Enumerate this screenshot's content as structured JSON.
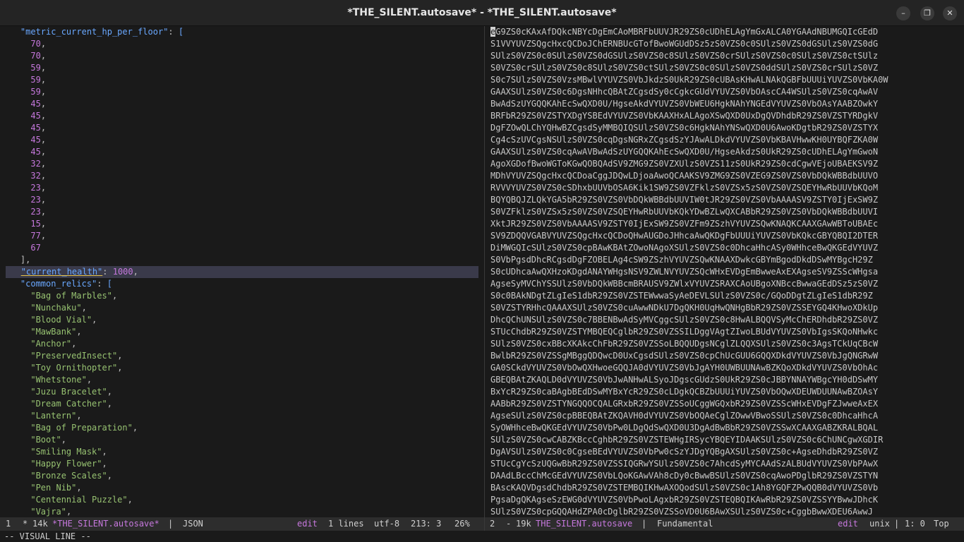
{
  "window": {
    "title": "*THE_SILENT.autosave* - *THE_SILENT.autosave*",
    "minimize_glyph": "–",
    "maximize_glyph": "❐",
    "close_glyph": "✕"
  },
  "left_pane": {
    "lines": [
      {
        "indent": "  ",
        "key": "\"metric_current_hp_per_floor\"",
        "after": ": ",
        "open": "["
      },
      {
        "indent": "    ",
        "num": "70",
        "after": ","
      },
      {
        "indent": "    ",
        "num": "70",
        "after": ","
      },
      {
        "indent": "    ",
        "num": "59",
        "after": ","
      },
      {
        "indent": "    ",
        "num": "59",
        "after": ","
      },
      {
        "indent": "    ",
        "num": "59",
        "after": ","
      },
      {
        "indent": "    ",
        "num": "45",
        "after": ","
      },
      {
        "indent": "    ",
        "num": "45",
        "after": ","
      },
      {
        "indent": "    ",
        "num": "45",
        "after": ","
      },
      {
        "indent": "    ",
        "num": "45",
        "after": ","
      },
      {
        "indent": "    ",
        "num": "45",
        "after": ","
      },
      {
        "indent": "    ",
        "num": "32",
        "after": ","
      },
      {
        "indent": "    ",
        "num": "32",
        "after": ","
      },
      {
        "indent": "    ",
        "num": "23",
        "after": ","
      },
      {
        "indent": "    ",
        "num": "23",
        "after": ","
      },
      {
        "indent": "    ",
        "num": "23",
        "after": ","
      },
      {
        "indent": "    ",
        "num": "15",
        "after": ","
      },
      {
        "indent": "    ",
        "num": "77",
        "after": ","
      },
      {
        "indent": "    ",
        "num": "67",
        "after": ""
      },
      {
        "indent": "  ",
        "punc": "],"
      },
      {
        "indent": "  ",
        "key": "\"current_health\"",
        "after": ": ",
        "num": "1000",
        "tail": ",",
        "highlight": true
      },
      {
        "indent": "  ",
        "key": "\"common_relics\"",
        "after": ": ",
        "open": "["
      },
      {
        "indent": "    ",
        "str": "\"Bag of Marbles\"",
        "after": ","
      },
      {
        "indent": "    ",
        "str": "\"Nunchaku\"",
        "after": ","
      },
      {
        "indent": "    ",
        "str": "\"Blood Vial\"",
        "after": ","
      },
      {
        "indent": "    ",
        "str": "\"MawBank\"",
        "after": ","
      },
      {
        "indent": "    ",
        "str": "\"Anchor\"",
        "after": ","
      },
      {
        "indent": "    ",
        "str": "\"PreservedInsect\"",
        "after": ","
      },
      {
        "indent": "    ",
        "str": "\"Toy Ornithopter\"",
        "after": ","
      },
      {
        "indent": "    ",
        "str": "\"Whetstone\"",
        "after": ","
      },
      {
        "indent": "    ",
        "str": "\"Juzu Bracelet\"",
        "after": ","
      },
      {
        "indent": "    ",
        "str": "\"Dream Catcher\"",
        "after": ","
      },
      {
        "indent": "    ",
        "str": "\"Lantern\"",
        "after": ","
      },
      {
        "indent": "    ",
        "str": "\"Bag of Preparation\"",
        "after": ","
      },
      {
        "indent": "    ",
        "str": "\"Boot\"",
        "after": ","
      },
      {
        "indent": "    ",
        "str": "\"Smiling Mask\"",
        "after": ","
      },
      {
        "indent": "    ",
        "str": "\"Happy Flower\"",
        "after": ","
      },
      {
        "indent": "    ",
        "str": "\"Bronze Scales\"",
        "after": ","
      },
      {
        "indent": "    ",
        "str": "\"Pen Nib\"",
        "after": ","
      },
      {
        "indent": "    ",
        "str": "\"Centennial Puzzle\"",
        "after": ","
      },
      {
        "indent": "    ",
        "str": "\"Vajra\"",
        "after": ","
      }
    ]
  },
  "right_pane": {
    "first_char": "e",
    "lines": [
      "G9ZS0cKAxAfDQkcNBYcDgEmCAoMBRFbUUVJR29ZS0cUDhELAgYmGxALCA0YGAAdNBUMGQIcGEdD",
      "S1VVYUVZSQgcHxcQCDoJChERNBUcGTofBwoWGUdDSz5zS0VZS0c0SUlzS0VZS0dGSUlzS0VZS0dG",
      "SUlzS0VZS0c0SUlzS0VZS0dGSUlzS0VZS0c8SUlzS0VZS0crSUlzS0VZS0c0SUlzS0VZS0ctSUlz",
      "S0VZS0crSUlzS0VZS0c8SUlzS0VZS0ctSUlzS0VZS0c0SUlzS0VZS0ddSUlzS0VZS0crSUlzS0VZ",
      "S0c7SUlzS0VZS0VzsMBwlVYUVZS0VbJkdzS0UkR29ZS0cUBAsKHwALNAkQGBFbUUUiYUVZS0VbKA0W",
      "GAAXSUlzS0VZS0c6DgsNHhcQBAtZCgsdSy0cCgkcGUdVYUVZS0VbOAscCA4WSUlzS0VZS0cqAwAV",
      "BwAdSzUYGQQKAhEcSwQXD0U/HgseAkdVYUVZS0VbWEU6HgkNAhYNGEdVYUVZS0VbOAsYAABZOwkY",
      "BRFbR29ZS0VZSTYXDgYSBEdVYUVZS0VbKAAXHxALAgoXSwQXD0UxDgQVDhdbR29ZS0VZSTYRDgkV",
      "DgFZOwQLChYQHwBZCgsdSyMMBQIQSUlzS0VZS0c6HgkNAhYNSwQXD0U6AwoKDgtbR29ZS0VZSTYX",
      "Cg4cSzUVCgsNSUlzS0VZS0cqDgsNGRxZCgsdSzYJAwALDkdVYUVZS0VbKBAVHwwKH0UYBQFZKA0W",
      "GAAXSUlzS0VZS0cqAwAVBwAdSzUYGQQKAhEcSwQXD0U/HgseAkdzS0UkR29ZS0cUDhELAgYmGwoN",
      "AgoXGDofBwoWGToKGwQOBQAdSV9ZMG9ZS0VZXUlzS0VZS11zS0UkR29ZS0cdCgwVEjoUBAEKSV9Z",
      "MDhVYUVZSQgcHxcQCDoaCggJDQwLDjoaAwoQCAAKSV9ZMG9ZS0VZEG9ZS0VZS0VbDQkWBBdbUUVO",
      "RVVVYUVZS0VZS0cSDhxbUUVbOSA6Kik1SW9ZS0VZFklzS0VZSx5zS0VZS0VZSQEYHwRbUUVbKQoM",
      "BQYQBQJZLQkYGA5bR29ZS0VZS0VbDQkWBBdbUUVIW0tJR29ZS0VZS0VbAAAASV9ZSTY0IjExSW9Z",
      "S0VZFklzS0VZSx5zS0VZS0VZSQEYHwRbUUVbKQkYDwBZLwQXCABbR29ZS0VZS0VbDQkWBBdbUUVI",
      "XktJR29ZS0VZS0VbAAAASV9ZSTY0IjExSW9ZS0VZFm9ZSzhVYUVZSQwKNAQKCAAXGAwWBToUBAEc",
      "SV9ZDQQVGABVYUVZSQgcHxcQCDoQHwAUGDoJHhcaAwQKDgFbUUUiYUVZS0VbKQkcGBYQBQI2DTER",
      "DiMWGQIcSUlzS0VZS0cpBAwKBAtZOwoNAgoXSUlzS0VZS0c0DhcaHhcASy0WHhceBwQKGEdVYUVZ",
      "S0VbPgsdDhcRCgsdDgFZOBELAg4cSW9ZSzhVYUVZSQwKNAAXDwkcGBYmBgodDkdDSwMYBgcH29Z",
      "S0cUDhcaAwQXHzoKDgdANAYWHgsNSV9ZWLNVYUVZSQcWHxEVDgEmBwweAxEXAgseSV9ZSScWHgsa",
      "AgseSyMVChYSSUlzS0VbDQkWBBcmBRAUSV9ZWlxVYUVZSRAXCAoUBgoXNBccBwwaGEdDSz5zS0VZ",
      "S0c0BAkNDgtZLgIeS1dbR29ZS0VZSTEWwwaSyAeDEVLSUlzS0VZS0c/GQoDDgtZLgIeS1dbR29Z",
      "S0VZSTYRHhcQAAAXSUlzS0VZS0cuAwwNDkU7DgQKH0UqHwQNHgBbR29ZS0VZSSEYGQ4KHwoXDkUp",
      "DhcQChUNSUlzS0VZS0c7BBENBwAdSyMVCggcSUlzS0VZS0c8HwALBQQVSyMcChERDhdbR29ZS0VZ",
      "STUcChdbR29ZS0VZSTYMBQEQCglbR29ZS0VZSSILDggVAgtZIwoLBUdVYUVZS0VbIgsSKQoNHwkc",
      "SUlzS0VZS0cxBBcXKAkcChFbR29ZS0VZSSoLBQQUDgsNCglZLQQXSUlzS0VZS0c3AgsTCkUqCBcW",
      "BwlbR29ZS0VZSSgMBggQDQwcD0UxCgsdSUlzS0VZS0cpChUcGUU6GQQXDkdVYUVZS0VbJgQNGRwW",
      "GA0SCkdVYUVZS0VbOwQXHwoeGQQJA0dVYUVZS0VbJgAYH0UWBUUNAwBZKQoXDkdVYUVZS0VbOhAc",
      "GBEQBAtZKAQLD0dVYUVZS0VbJwANHwALSyoJDgscGUdzS0UkR29ZS0cJBBYNNAYWBgcYH0dDSwMY",
      "BxYcR29ZS0caBAgbBEdDSwMYBxYcR29ZS0cLDgkQCBZbUUUiYUVZS0VbOQwXDEUWDUUNAwBZOAsY",
      "AABbR29ZS0VZSTYNGQQOCQALGRxbR29ZS0VZSSoUCggWGQxbR29ZS0VZSScWHxEVDgFZJwweAxEX",
      "AgseSUlzS0VZS0cpBBEQBAtZKQAVH0dVYUVZS0VbOQAeCglZOwwVBwoSSUlzS0VZS0c0DhcaHhcA",
      "SyOWHhceBwQKGEdVYUVZS0VbPw0LDgQdSwQXD0U3DgAdBwBbR29ZS0VZSSwXCAAXGABZKRALBQAL",
      "SUlzS0VZS0cwCABZKBccCghbR29ZS0VZSTEWHgIRSycYBQEYIDAAKSUlzS0VZS0c6ChUNCgwXGDIR",
      "DgAVSUlzS0VZS0c0CgseBEdVYUVZS0VbPw0cSzYJDgYQBgAXSUlzS0VZS0c+AgseDhdbR29ZS0VZ",
      "STUcCgYcSzUQGwBbR29ZS0VZSSIQGRwYSUlzS0VZS0c7AhcdSyMYCAAdSzALBUdVYUVZS0VbPAwX",
      "DAAdLBccChMcGEdVYUVZS0VbLQoKGAwVAh8cDy0cBwwBSUlzS0VZS0cqAwoPDglbR29ZS0VZSTYN",
      "BAscKAQVDgsdChdbR29ZS0VZSTEMBQIKHwAXOQodSUlzS0VZS0c1Ah8YGQFZPwQQB0dVYUVZS0Vb",
      "PgsaDgQKAgseSzEWG0dVYUVZS0VbPwoLAgxbR29ZS0VZSTEQBQIKAwRbR29ZS0VZSSYYBwwJDhcK",
      "SUlzS0VZS0cpGQQAHdZPA0cDglbR29ZS0VZSSoVD0U6BAwXSUlzS0VZS0c+CggbBwwXDEU6AwwJ"
    ]
  },
  "left_modeline": {
    "window_num": "1",
    "modified": "*",
    "size": "14k",
    "buffer": "*THE_SILENT.autosave*",
    "sep": "|",
    "mode": "JSON",
    "state": "edit",
    "lines_info": "1 lines",
    "encoding": "utf-8",
    "position": "213: 3",
    "percent": "26%"
  },
  "right_modeline": {
    "window_num": "2",
    "modified": "-",
    "size": "19k",
    "buffer": "THE_SILENT.autosave",
    "sep": "|",
    "mode": "Fundamental",
    "state": "edit",
    "eol": "unix",
    "sep2": "|",
    "position": "1: 0",
    "percent": "Top"
  },
  "echo_area": "-- VISUAL LINE --",
  "colors": {
    "key": "#6aa8ff",
    "number": "#c678dd",
    "string": "#97c271",
    "modeline_bg": "#2d2d2d",
    "highlight_bg": "#3a3a4a"
  }
}
